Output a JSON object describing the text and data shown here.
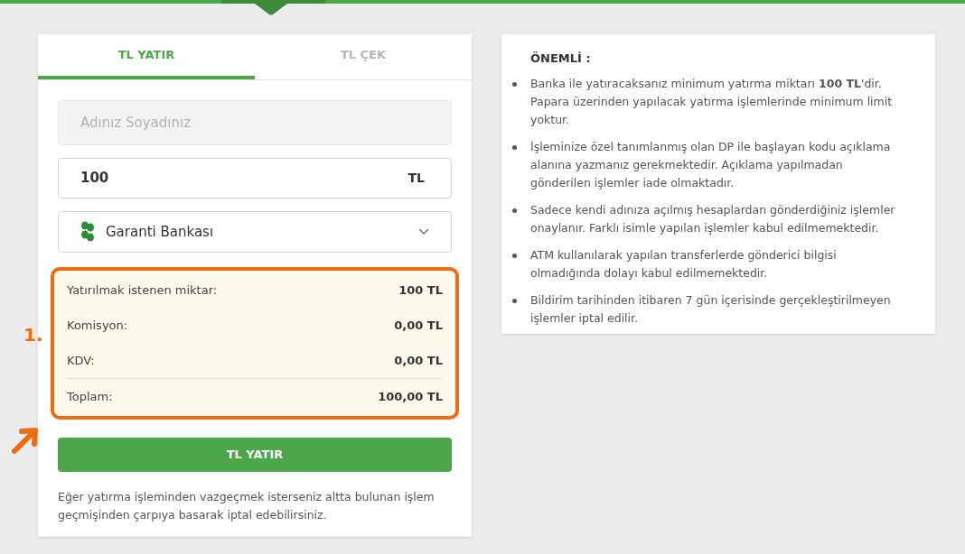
{
  "tabs": [
    {
      "label": "TL YATIR",
      "selected": true
    },
    {
      "label": "TL ÇEK",
      "selected": false
    }
  ],
  "form": {
    "name_field": {
      "placeholder": "Adınız Soyadınız"
    },
    "amount_field": {
      "value": "100",
      "unit": "TL"
    },
    "bank_select": {
      "value": "Garanti Bankası"
    }
  },
  "summary": {
    "rows": [
      {
        "label": "Yatırılmak istenen miktar:",
        "value": "100 TL"
      },
      {
        "label": "Komisyon:",
        "value": "0,00 TL"
      },
      {
        "label": "KDV:",
        "value": "0,00 TL"
      }
    ],
    "total": {
      "label": "Toplam:",
      "value": "100,00 TL"
    }
  },
  "annotation": {
    "label": "1."
  },
  "submit_button": "TL YATIR",
  "note": "Eğer yatırma işleminden vazgeçmek isterseniz altta bulunan işlem geçmişinden çarpıya basarak iptal edebilirsiniz.",
  "info": {
    "title": "ÖNEMLİ :",
    "items": [
      "Banka ile yatıracaksanız minimum yatırma miktarı **100 TL**'dir. Papara üzerinden yapılacak yatırma işlemlerinde minimum limit yoktur.",
      "İşleminize özel tanımlanmış olan DP ile başlayan kodu açıklama alanına yazmanız gerekmektedir. Açıklama yapılmadan gönderilen işlemler iade olmaktadır.",
      "Sadece kendi adınıza açılmış hesaplardan gönderdiğiniz işlemler onaylanır. Farklı isimle yapılan işlemler kabul edilmemektedir.",
      "ATM kullanılarak yapılan transferlerde gönderici bilgisi olmadığında dolayı kabul edilmemektedir.",
      "Bildirim tarihinden itibaren 7 gün içerisinde gerçekleştirilmeyen işlemler iptal edilir."
    ]
  }
}
